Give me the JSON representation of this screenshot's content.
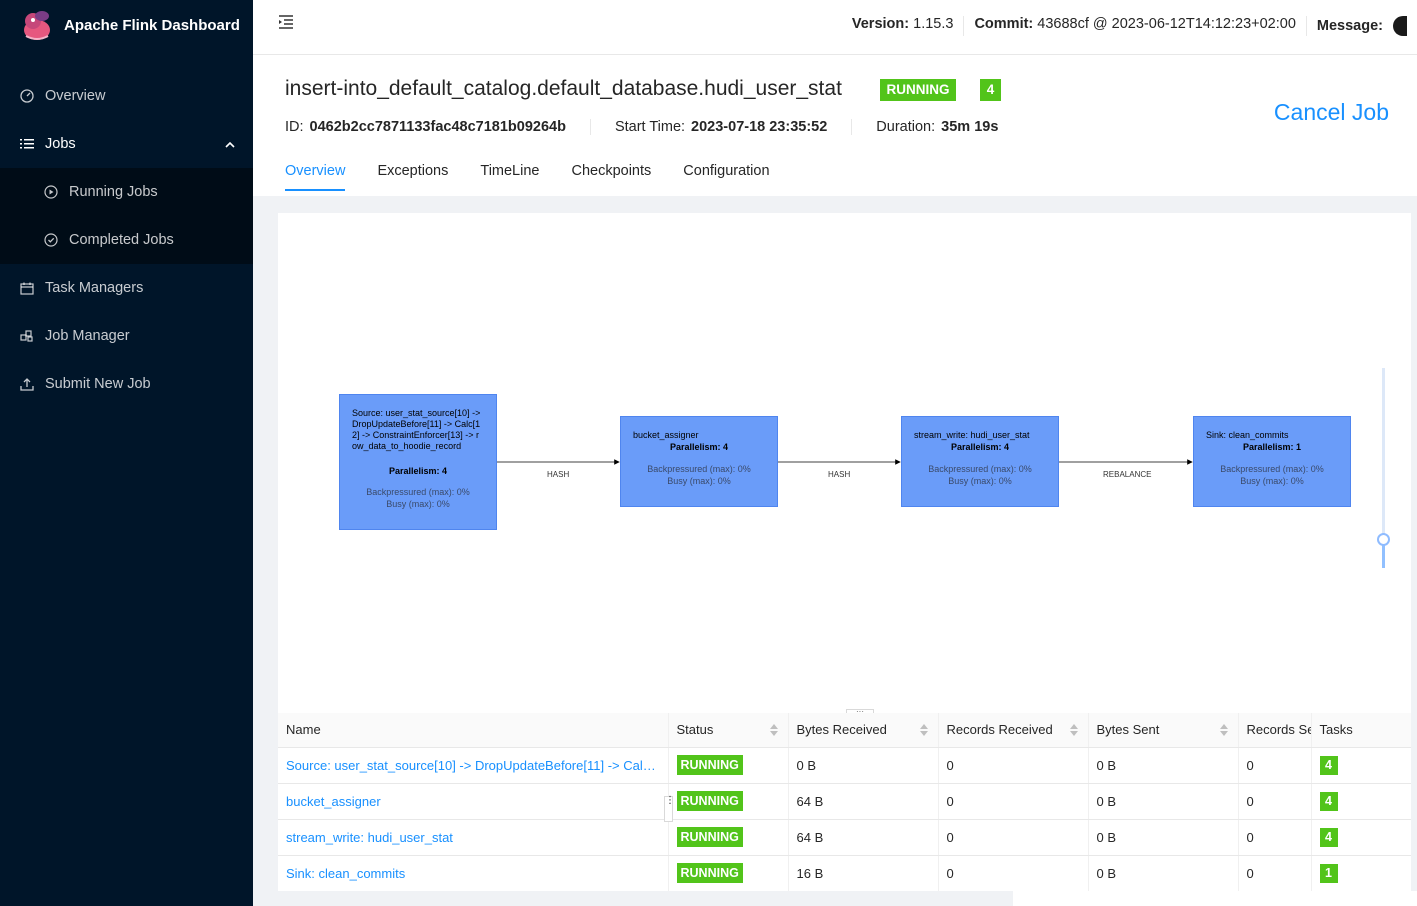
{
  "app": {
    "title": "Apache Flink Dashboard"
  },
  "sidebar": {
    "items": [
      {
        "label": "Overview",
        "icon": "dashboard-icon"
      },
      {
        "label": "Jobs",
        "icon": "list-icon",
        "expanded": true
      },
      {
        "label": "Running Jobs",
        "icon": "play-circle-icon"
      },
      {
        "label": "Completed Jobs",
        "icon": "check-circle-icon"
      },
      {
        "label": "Task Managers",
        "icon": "schedule-icon"
      },
      {
        "label": "Job Manager",
        "icon": "build-icon"
      },
      {
        "label": "Submit New Job",
        "icon": "upload-icon"
      }
    ]
  },
  "header": {
    "version_label": "Version:",
    "version": "1.15.3",
    "commit_label": "Commit:",
    "commit": "43688cf @ 2023-06-12T14:12:23+02:00",
    "message_label": "Message:"
  },
  "job": {
    "name": "insert-into_default_catalog.default_database.hudi_user_stat",
    "status": "RUNNING",
    "task_count": "4",
    "id_label": "ID:",
    "id": "0462b2cc7871133fac48c7181b09264b",
    "start_label": "Start Time:",
    "start_time": "2023-07-18 23:35:52",
    "duration_label": "Duration:",
    "duration": "35m 19s",
    "cancel_label": "Cancel Job"
  },
  "tabs": [
    "Overview",
    "Exceptions",
    "TimeLine",
    "Checkpoints",
    "Configuration"
  ],
  "graph": {
    "nodes": [
      {
        "title": "Source: user_stat_source[10] -> DropUpdateBefore[11] -> Calc[12] -> ConstraintEnforcer[13] -> row_data_to_hoodie_record",
        "parallelism": "Parallelism: 4",
        "backpressured": "Backpressured (max): 0%",
        "busy": "Busy (max): 0%"
      },
      {
        "title": "bucket_assigner",
        "parallelism": "Parallelism: 4",
        "backpressured": "Backpressured (max): 0%",
        "busy": "Busy (max): 0%"
      },
      {
        "title": "stream_write: hudi_user_stat",
        "parallelism": "Parallelism: 4",
        "backpressured": "Backpressured (max): 0%",
        "busy": "Busy (max): 0%"
      },
      {
        "title": "Sink: clean_commits",
        "parallelism": "Parallelism: 1",
        "backpressured": "Backpressured (max): 0%",
        "busy": "Busy (max): 0%"
      }
    ],
    "edges": [
      "HASH",
      "HASH",
      "REBALANCE"
    ]
  },
  "table": {
    "headers": [
      "Name",
      "Status",
      "Bytes Received",
      "Records Received",
      "Bytes Sent",
      "Records Se",
      "Tasks"
    ],
    "rows": [
      {
        "name": "Source: user_stat_source[10] -> DropUpdateBefore[11] -> Calc...",
        "status": "RUNNING",
        "bytes_received": "0 B",
        "records_received": "0",
        "bytes_sent": "0 B",
        "records_sent": "0",
        "tasks": "4"
      },
      {
        "name": "bucket_assigner",
        "status": "RUNNING",
        "bytes_received": "64 B",
        "records_received": "0",
        "bytes_sent": "0 B",
        "records_sent": "0",
        "tasks": "4"
      },
      {
        "name": "stream_write: hudi_user_stat",
        "status": "RUNNING",
        "bytes_received": "64 B",
        "records_received": "0",
        "bytes_sent": "0 B",
        "records_sent": "0",
        "tasks": "4"
      },
      {
        "name": "Sink: clean_commits",
        "status": "RUNNING",
        "bytes_received": "16 B",
        "records_received": "0",
        "bytes_sent": "0 B",
        "records_sent": "0",
        "tasks": "1"
      }
    ]
  },
  "colors": {
    "sidebar_bg": "#001529",
    "accent": "#1890ff",
    "success": "#52c41a",
    "node_fill": "#6a9cf9"
  }
}
